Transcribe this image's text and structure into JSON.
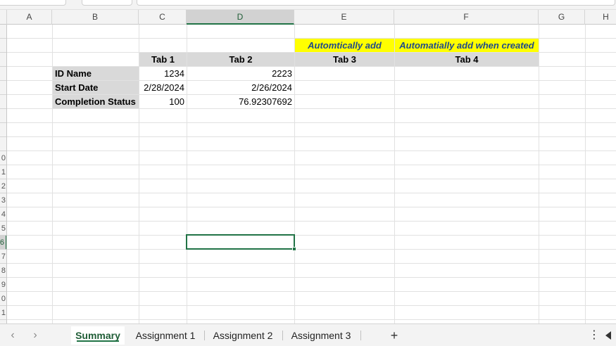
{
  "columns": [
    "A",
    "B",
    "C",
    "D",
    "E",
    "F",
    "G",
    "H"
  ],
  "selected_column": "D",
  "rows": [
    "",
    "",
    "",
    "",
    "",
    "",
    "",
    "",
    "",
    "0",
    "1",
    "2",
    "3",
    "4",
    "5",
    "6",
    "7",
    "8",
    "9",
    "0",
    "1"
  ],
  "selected_row": "6",
  "notes": {
    "e": "Automtically add",
    "f": "Automatially add when created"
  },
  "table": {
    "headers": [
      "Tab 1",
      "Tab 2",
      "Tab 3",
      "Tab 4"
    ],
    "row_labels": [
      "ID Name",
      "Start Date",
      "Completion Status"
    ],
    "tab1": [
      "1234",
      "2/28/2024",
      "100"
    ],
    "tab2": [
      "2223",
      "2/26/2024",
      "76.92307692"
    ]
  },
  "sheets": {
    "tabs": [
      "Summary",
      "Assignment 1",
      "Assignment 2",
      "Assignment 3"
    ],
    "active": "Summary",
    "add": "+",
    "menu": "⋮",
    "prev": "‹",
    "next": "›"
  },
  "colors": {
    "accent": "#217346",
    "header_fill": "#d9d9d9",
    "note_fill": "#ffff00",
    "note_text": "#1f4a8a"
  }
}
